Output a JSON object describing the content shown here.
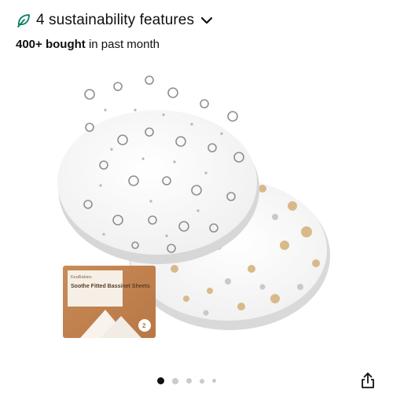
{
  "sustainability": {
    "label": "4 sustainability features",
    "icon": "leaf-icon",
    "expand_icon": "chevron-down-icon",
    "accent_color": "#067d62"
  },
  "purchase": {
    "count": "400+ bought",
    "suffix": "in past month"
  },
  "product_image": {
    "box_brand": "KeaBabies",
    "box_title": "Soothe Fitted Bassinet Sheets",
    "box_count": "2"
  },
  "carousel": {
    "total": 5,
    "active_index": 0
  },
  "share": {
    "icon": "share-icon"
  }
}
